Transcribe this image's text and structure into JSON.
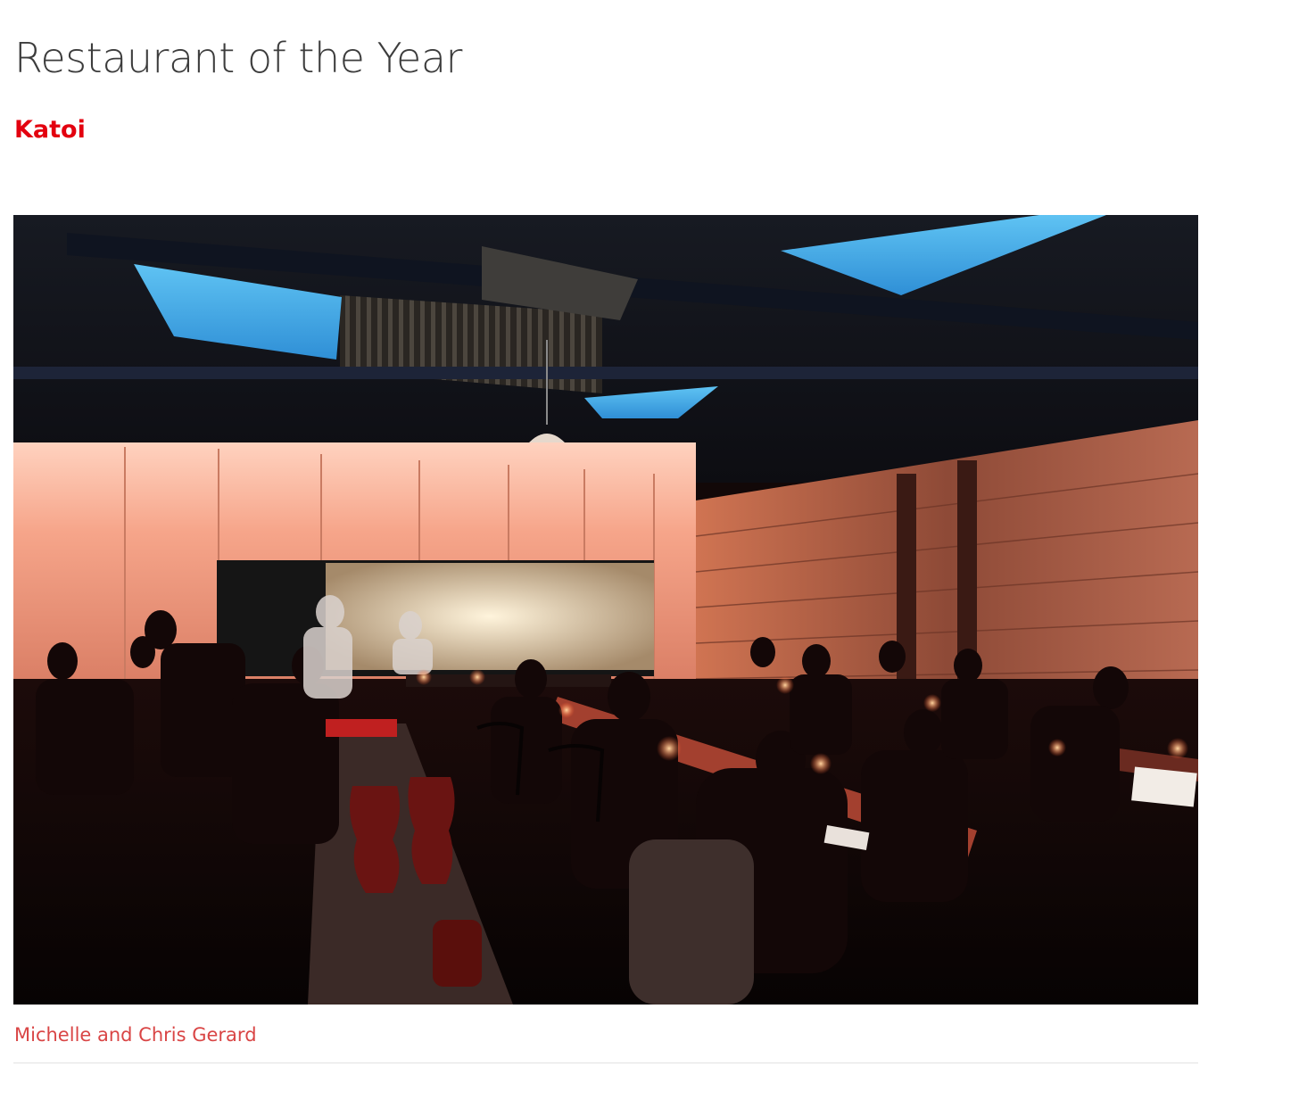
{
  "header": {
    "title": "Restaurant of the Year",
    "restaurant_name": "Katoi"
  },
  "photo": {
    "credit": "Michelle and Chris Gerard"
  },
  "colors": {
    "accent": "#e3000f",
    "caption": "#d94545",
    "title": "#3c3c3c",
    "divider": "#e2e2e2"
  }
}
